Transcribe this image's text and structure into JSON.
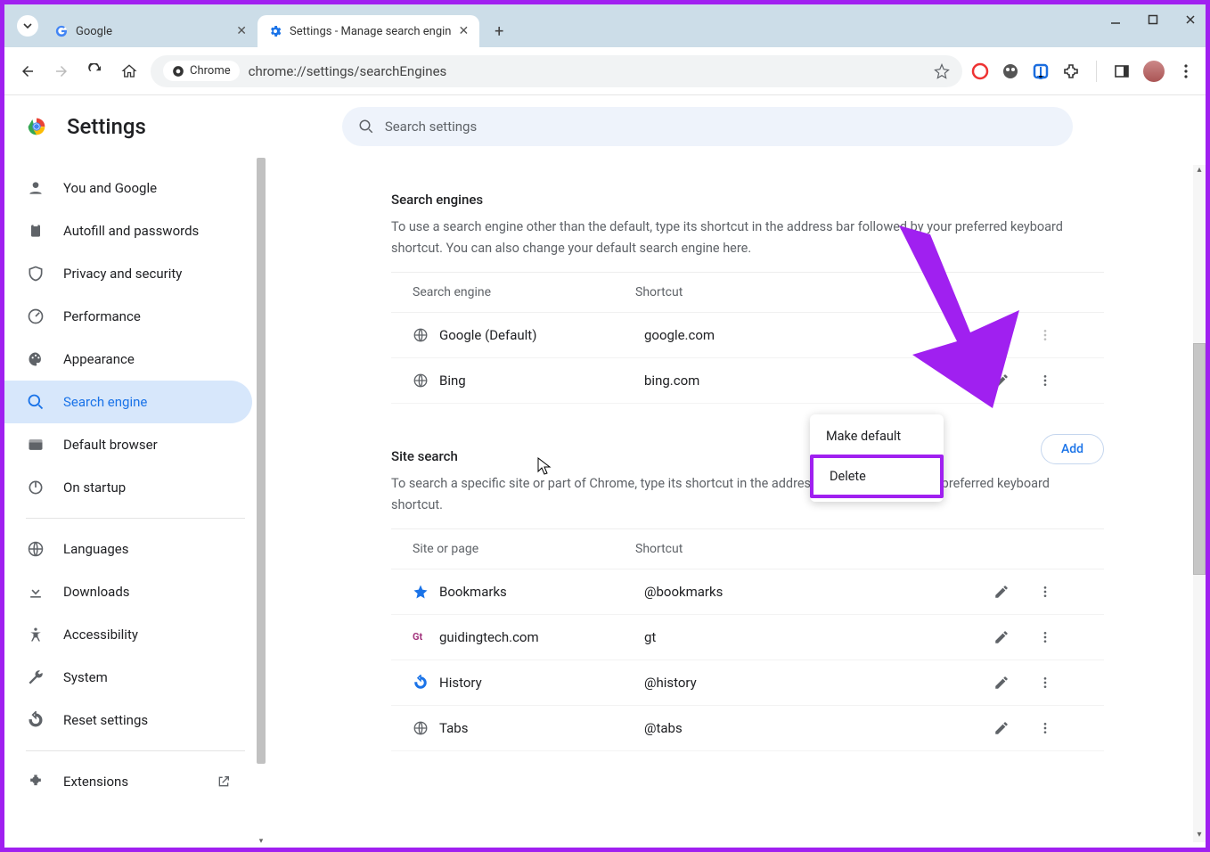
{
  "tabs": [
    {
      "title": "Google"
    },
    {
      "title": "Settings - Manage search engin"
    }
  ],
  "omnibox": {
    "chip": "Chrome",
    "url": "chrome://settings/searchEngines"
  },
  "header": {
    "title": "Settings",
    "search_placeholder": "Search settings"
  },
  "sidebar": {
    "items": [
      {
        "label": "You and Google"
      },
      {
        "label": "Autofill and passwords"
      },
      {
        "label": "Privacy and security"
      },
      {
        "label": "Performance"
      },
      {
        "label": "Appearance"
      },
      {
        "label": "Search engine"
      },
      {
        "label": "Default browser"
      },
      {
        "label": "On startup"
      }
    ],
    "items2": [
      {
        "label": "Languages"
      },
      {
        "label": "Downloads"
      },
      {
        "label": "Accessibility"
      },
      {
        "label": "System"
      },
      {
        "label": "Reset settings"
      }
    ],
    "extensions": "Extensions"
  },
  "search_engines": {
    "heading": "Search engines",
    "sub": "To use a search engine other than the default, type its shortcut in the address bar followed by your preferred keyboard shortcut. You can also change your default search engine here.",
    "head_a": "Search engine",
    "head_b": "Shortcut",
    "rows": [
      {
        "name": "Google (Default)",
        "shortcut": "google.com",
        "edit": false,
        "more": true
      },
      {
        "name": "Bing",
        "shortcut": "bing.com",
        "edit": true,
        "more": true
      }
    ]
  },
  "site_search": {
    "heading": "Site search",
    "sub": "To search a specific site or part of Chrome, type its shortcut in the address bar, followed by your preferred keyboard shortcut.",
    "add": "Add",
    "head_a": "Site or page",
    "head_b": "Shortcut",
    "rows": [
      {
        "name": "Bookmarks",
        "shortcut": "@bookmarks",
        "icon": "star"
      },
      {
        "name": "guidingtech.com",
        "shortcut": "gt",
        "icon": "gt"
      },
      {
        "name": "History",
        "shortcut": "@history",
        "icon": "history"
      },
      {
        "name": "Tabs",
        "shortcut": "@tabs",
        "icon": "globe"
      }
    ]
  },
  "ctx": {
    "make_default": "Make default",
    "delete": "Delete"
  }
}
